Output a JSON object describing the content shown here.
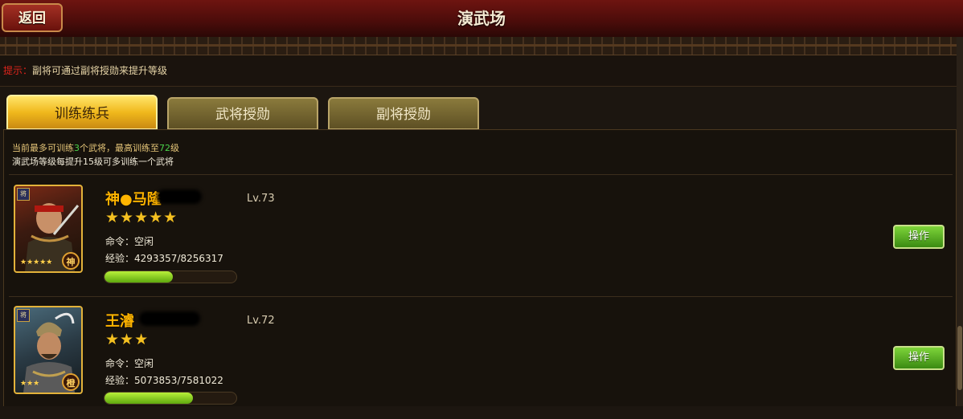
{
  "header": {
    "title": "演武场",
    "back_label": "返回"
  },
  "tip": {
    "label": "提示：",
    "text": "副将可通过副将授勋来提升等级"
  },
  "tabs": [
    {
      "label": "训练练兵",
      "active": true
    },
    {
      "label": "武将授勋",
      "active": false
    },
    {
      "label": "副将授勋",
      "active": false
    }
  ],
  "info": {
    "line1_a": "当前最多可训练",
    "max_count": "3",
    "line1_b": "个武将，最高训练至",
    "max_level": "72",
    "line1_c": "级",
    "line2": "演武场等级每提升15级可多训练一个武将"
  },
  "generals": [
    {
      "name": "神●马隆",
      "level": "Lv.73",
      "stars": "★★★★★",
      "star_count": 5,
      "command": "命令：空闲",
      "exp": "经验：4293357/8256317",
      "exp_progress": 0.52,
      "badge": "神",
      "card_stars": "★★★★★",
      "corner_tag": "将",
      "action_label": "操作"
    },
    {
      "name": "王濬",
      "level": "Lv.72",
      "stars": "★★★",
      "star_count": 3,
      "command": "命令：空闲",
      "exp": "经验：5073853/7581022",
      "exp_progress": 0.67,
      "badge": "橙",
      "card_stars": "★★★",
      "corner_tag": "将",
      "action_label": "操作"
    }
  ],
  "colors": {
    "accent_gold": "#ffb400",
    "tip_red": "#e0241c",
    "highlight_green": "#4ad24a",
    "button_green": "#5ea80e"
  }
}
